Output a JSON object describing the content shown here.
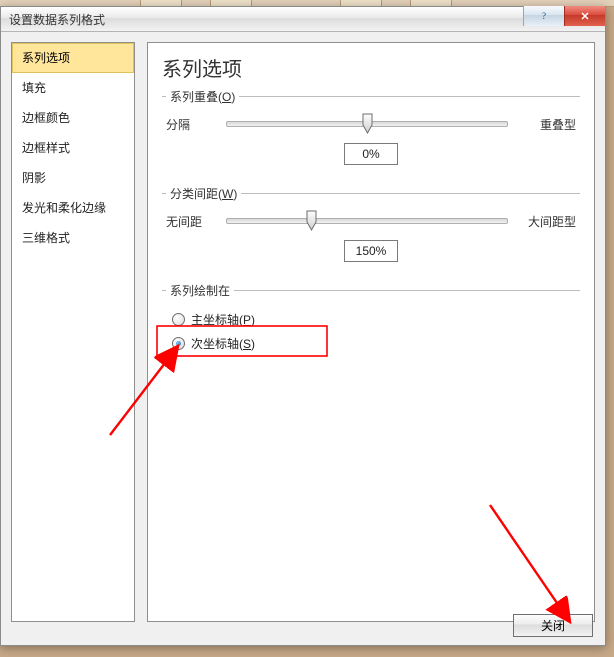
{
  "window": {
    "title": "设置数据系列格式",
    "help_tooltip": "帮助",
    "close_tooltip": "关闭"
  },
  "sidebar": {
    "items": [
      {
        "label": "系列选项",
        "name": "sidebar-item-series-options",
        "selected": true
      },
      {
        "label": "填充",
        "name": "sidebar-item-fill",
        "selected": false
      },
      {
        "label": "边框颜色",
        "name": "sidebar-item-border-color",
        "selected": false
      },
      {
        "label": "边框样式",
        "name": "sidebar-item-border-style",
        "selected": false
      },
      {
        "label": "阴影",
        "name": "sidebar-item-shadow",
        "selected": false
      },
      {
        "label": "发光和柔化边缘",
        "name": "sidebar-item-glow-soft",
        "selected": false
      },
      {
        "label": "三维格式",
        "name": "sidebar-item-3d-format",
        "selected": false
      }
    ]
  },
  "panel": {
    "heading": "系列选项",
    "overlap": {
      "legend": "系列重叠(O)",
      "left": "分隔",
      "right": "重叠型",
      "value": "0%",
      "percent_pos": 50
    },
    "gap": {
      "legend": "分类间距(W)",
      "left": "无间距",
      "right": "大间距型",
      "value": "150%",
      "percent_pos": 30
    },
    "axis": {
      "legend": "系列绘制在",
      "primary_label": "主坐标轴(P)",
      "secondary_label": "次坐标轴(S)",
      "selected": "secondary"
    }
  },
  "buttons": {
    "close": "关闭"
  }
}
